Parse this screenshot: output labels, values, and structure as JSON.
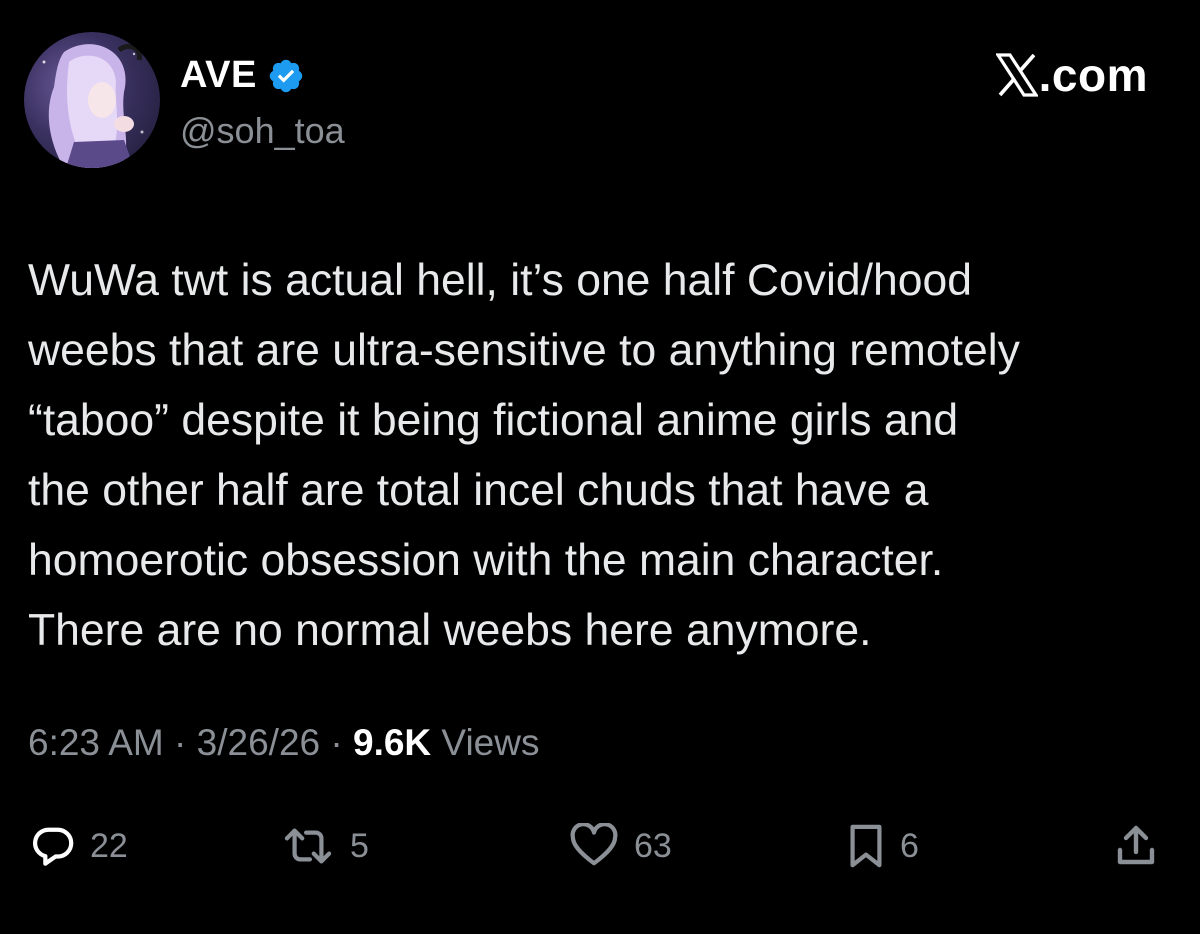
{
  "author": {
    "display_name": "AVE",
    "handle": "@soh_toa",
    "verified": true
  },
  "brand": {
    "suffix": ".com",
    "logo": "x-logo-icon"
  },
  "tweet": {
    "lines": [
      "WuWa twt is actual hell, it’s one half Covid/hood",
      "weebs that are ultra-sensitive to anything remotely",
      "“taboo” despite it being fictional anime girls and",
      "the other half are total incel chuds that have a",
      "homoerotic obsession with the main character.",
      "There are no normal weebs here anymore."
    ]
  },
  "meta": {
    "time": "6:23 AM",
    "date": "3/26/26",
    "separator": " · ",
    "views_count": "9.6K",
    "views_label": " Views"
  },
  "actions": {
    "replies": "22",
    "reposts": "5",
    "likes": "63",
    "bookmarks": "6"
  },
  "colors": {
    "background": "#000000",
    "text": "#e7e9ea",
    "secondary": "#8b9096",
    "verified": "#1d9bf0"
  }
}
